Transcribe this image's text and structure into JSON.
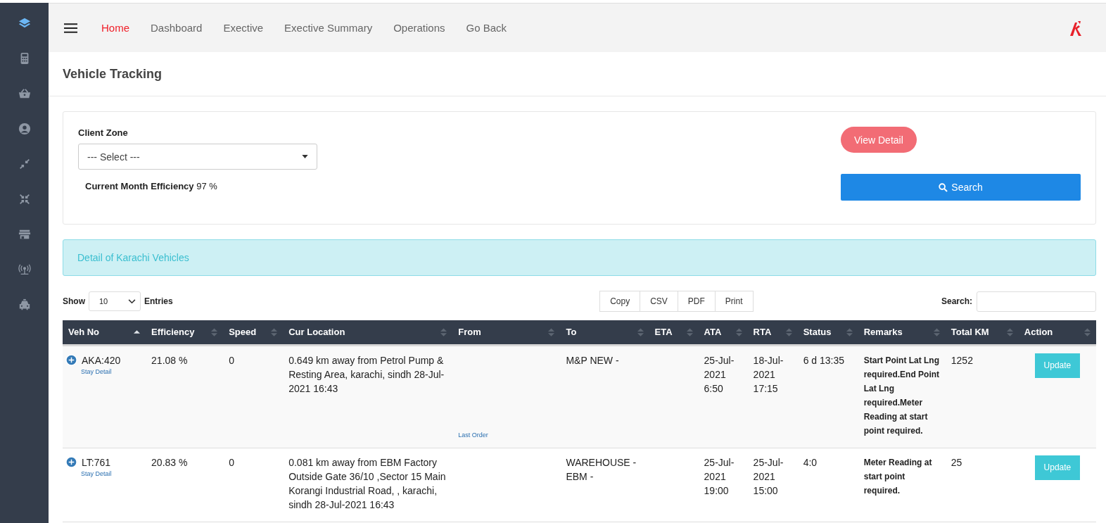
{
  "sidebar": {
    "items": [
      {
        "selected": true
      },
      {
        "selected": false
      },
      {
        "selected": false
      },
      {
        "selected": false
      },
      {
        "selected": false
      },
      {
        "selected": false
      },
      {
        "selected": false
      },
      {
        "selected": false
      },
      {
        "selected": false
      }
    ]
  },
  "nav": {
    "items": [
      {
        "label": "Home",
        "selected": true
      },
      {
        "label": "Dashboard",
        "selected": false
      },
      {
        "label": "Exective",
        "selected": false
      },
      {
        "label": "Exective Summary",
        "selected": false
      },
      {
        "label": "Operations",
        "selected": false
      },
      {
        "label": "Go Back",
        "selected": false
      }
    ]
  },
  "page_title": "Vehicle Tracking",
  "filter": {
    "label": "Client Zone",
    "select_value": "--- Select ---",
    "efficiency_label": "Current Month Efficiency",
    "efficiency_value": "97 %",
    "view_detail_button": "View Detail",
    "search_button": "Search"
  },
  "alert": "Detail of Karachi Vehicles",
  "table_controls": {
    "show_label": "Show",
    "page_size": "10",
    "entries_label": "Entries",
    "export_buttons": [
      "Copy",
      "CSV",
      "PDF",
      "Print"
    ],
    "search_label": "Search:"
  },
  "table": {
    "columns": [
      {
        "label": "Veh No",
        "sorted": true
      },
      {
        "label": "Efficiency",
        "sorted": false
      },
      {
        "label": "Speed",
        "sorted": false
      },
      {
        "label": "Cur Location",
        "sorted": false
      },
      {
        "label": "From",
        "sorted": false
      },
      {
        "label": "To",
        "sorted": false
      },
      {
        "label": "ETA",
        "sorted": false
      },
      {
        "label": "ATA",
        "sorted": false
      },
      {
        "label": "RTA",
        "sorted": false
      },
      {
        "label": "Status",
        "sorted": false
      },
      {
        "label": "Remarks",
        "sorted": false
      },
      {
        "label": "Total KM",
        "sorted": false
      },
      {
        "label": "Action",
        "sorted": false
      }
    ],
    "rows": [
      {
        "veh_no": "AKA:420",
        "stay_link": "Stay Detail",
        "efficiency": "21.08 %",
        "speed": "0",
        "cur_location": "0.649 km away from Petrol Pump & Resting Area, karachi, sindh 28-Jul-2021 16:43",
        "from_link": "Last Order",
        "to": "M&P NEW -",
        "ata": "25-Jul-2021 6:50",
        "rta": "18-Jul-2021 17:15",
        "status": "6 d 13:35",
        "remarks": "Start Point Lat Lng required.End Point Lat Lng required.Meter Reading at start point required.",
        "total_km": "1252",
        "action": "Update"
      },
      {
        "veh_no": "LT:761",
        "stay_link": "Stay Detail",
        "efficiency": "20.83 %",
        "speed": "0",
        "cur_location": "0.081 km away from EBM Factory Outside Gate 36/10 ,Sector 15 Main Korangi Industrial Road, , karachi, sindh 28-Jul-2021 16:43",
        "to": "WAREHOUSE - EBM -",
        "ata": "25-Jul-2021 19:00",
        "rta": "25-Jul-2021 15:00",
        "status": "4:0",
        "remarks": "Meter Reading at start point required.",
        "total_km": "25",
        "action": "Update"
      }
    ]
  }
}
